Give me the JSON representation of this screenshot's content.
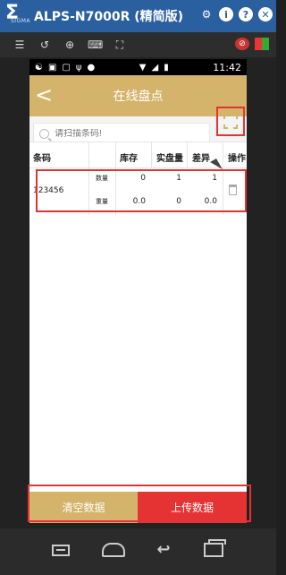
{
  "window": {
    "brand": "SIGMA",
    "title": "ALPS-N7000R (精简版)",
    "icons": [
      "gear-icon",
      "info-icon",
      "help-icon",
      "close-icon"
    ]
  },
  "toolbar": {
    "icons": [
      "list-icon",
      "rotate-icon",
      "zoom-icon",
      "keyboard-icon",
      "fullscreen-icon",
      "no-sound-icon",
      "windows-icon"
    ]
  },
  "statusbar": {
    "time": "11:42"
  },
  "header": {
    "back_glyph": "<",
    "title": "在线盘点"
  },
  "search": {
    "placeholder": "请扫描条码!"
  },
  "table": {
    "columns": [
      "条码",
      "库存",
      "实盘量",
      "差异",
      "操作"
    ],
    "rows": [
      {
        "barcode": "123456",
        "qty_label": "数量",
        "qty_stock": "0",
        "qty_actual": "1",
        "qty_diff": "1",
        "weight_label": "重量",
        "weight_stock": "0.0",
        "weight_actual": "0",
        "weight_diff": "0.0"
      }
    ]
  },
  "buttons": {
    "clear": "清空数据",
    "upload": "上传数据"
  },
  "colors": {
    "accent": "#d4b36a",
    "danger": "#e53333",
    "titlebar": "#2a5fa0"
  }
}
